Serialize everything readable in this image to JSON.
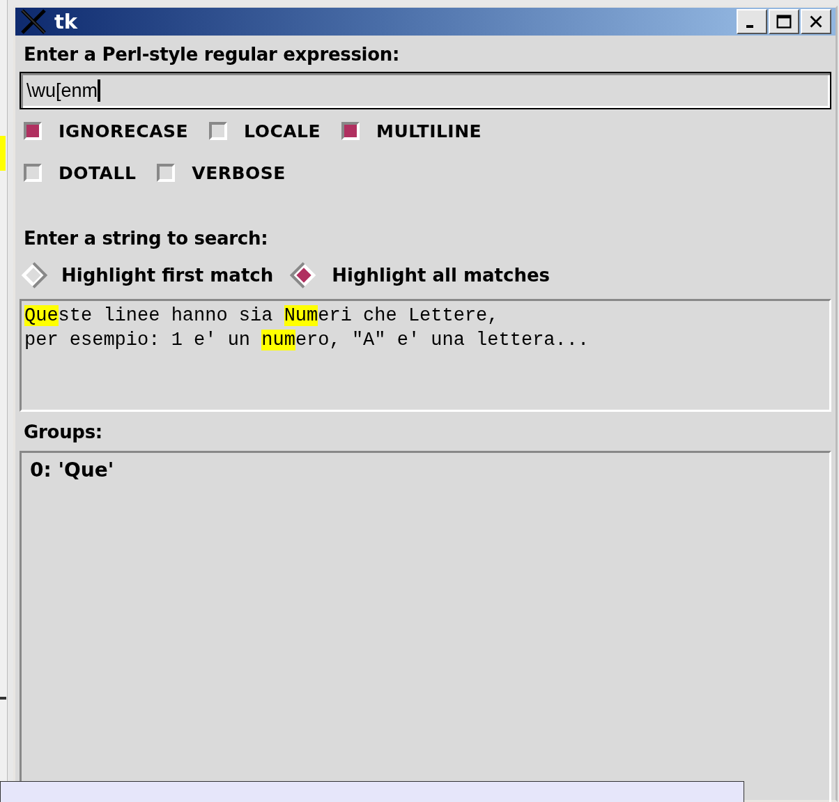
{
  "window": {
    "title": "tk"
  },
  "regex": {
    "label": "Enter a Perl-style regular expression:",
    "value": "\\wu[enm"
  },
  "flags": [
    {
      "label": "IGNORECASE",
      "checked": true
    },
    {
      "label": "LOCALE",
      "checked": false
    },
    {
      "label": "MULTILINE",
      "checked": true
    },
    {
      "label": "DOTALL",
      "checked": false
    },
    {
      "label": "VERBOSE",
      "checked": false
    }
  ],
  "search": {
    "label": "Enter a string to search:"
  },
  "modes": [
    {
      "label": "Highlight first match",
      "selected": false
    },
    {
      "label": "Highlight all matches",
      "selected": true
    }
  ],
  "text_lines": [
    [
      {
        "text": "Que",
        "highlighted": true
      },
      {
        "text": "ste linee hanno sia ",
        "highlighted": false
      },
      {
        "text": "Num",
        "highlighted": true
      },
      {
        "text": "eri che Lettere,",
        "highlighted": false
      }
    ],
    [
      {
        "text": "per esempio: 1 e' un ",
        "highlighted": false
      },
      {
        "text": "num",
        "highlighted": true
      },
      {
        "text": "ero, \"A\" e' una lettera...",
        "highlighted": false
      }
    ]
  ],
  "groups": {
    "label": "Groups:",
    "lines": [
      "0: 'Que'"
    ]
  }
}
